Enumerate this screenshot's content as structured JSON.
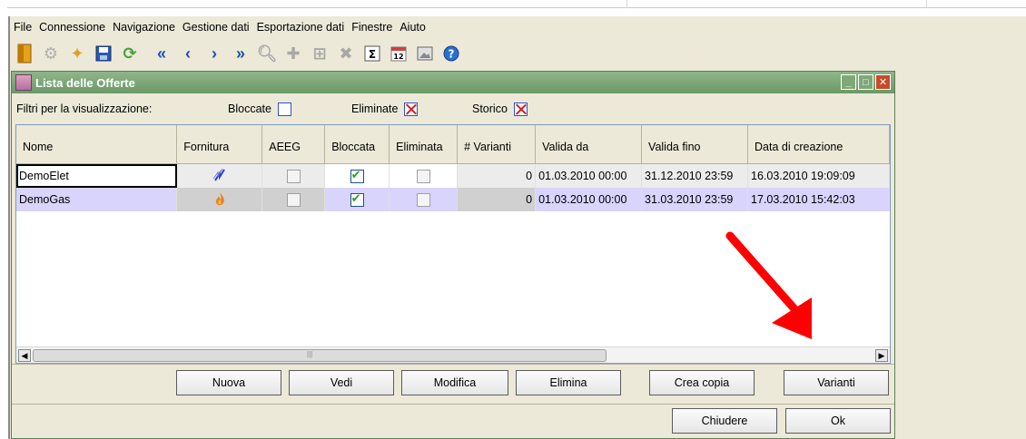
{
  "menu": [
    "File",
    "Connessione",
    "Navigazione",
    "Gestione dati",
    "Esportazione dati",
    "Finestre",
    "Aiuto"
  ],
  "toolbar_icons": [
    "exit-icon",
    "connect-icon",
    "plugin-icon",
    "save-icon",
    "refresh-icon",
    "first-icon",
    "previous-icon",
    "next-icon",
    "last-icon",
    "search-icon",
    "add-icon",
    "merge-icon",
    "delete-icon",
    "sum-icon",
    "calendar-icon",
    "image-icon",
    "help-icon"
  ],
  "window": {
    "title": "Lista delle Offerte",
    "filters_label": "Filtri per la visualizzazione:",
    "filters": [
      {
        "label": "Bloccate",
        "checked": false
      },
      {
        "label": "Eliminate",
        "checked": true
      },
      {
        "label": "Storico",
        "checked": true
      }
    ]
  },
  "table": {
    "columns": [
      "Nome",
      "Fornitura",
      "AEEG",
      "Bloccata",
      "Eliminata",
      "# Varianti",
      "Valida da",
      "Valida fino",
      "Data di creazione"
    ],
    "rows": [
      {
        "nome": "DemoElet",
        "fornitura": "electricity-icon",
        "aeeg": false,
        "bloccata": true,
        "eliminata": false,
        "varianti": "0",
        "valida_da": "01.03.2010 00:00",
        "valida_fino": "31.12.2010 23:59",
        "creazione": "16.03.2010 19:09:09"
      },
      {
        "nome": "DemoGas",
        "fornitura": "gas-flame-icon",
        "aeeg": false,
        "bloccata": true,
        "eliminata": false,
        "varianti": "0",
        "valida_da": "01.03.2010 00:00",
        "valida_fino": "31.03.2010 23:59",
        "creazione": "17.03.2010 15:42:03"
      }
    ]
  },
  "buttons": {
    "nuova": "Nuova",
    "vedi": "Vedi",
    "modifica": "Modifica",
    "elimina": "Elimina",
    "crea_copia": "Crea copia",
    "varianti": "Varianti",
    "chiudere": "Chiudere",
    "ok": "Ok"
  },
  "colors": {
    "title_bar": "#7fa877",
    "annotation_arrow": "#ff0000",
    "selected_row": "#d8d4fb"
  }
}
